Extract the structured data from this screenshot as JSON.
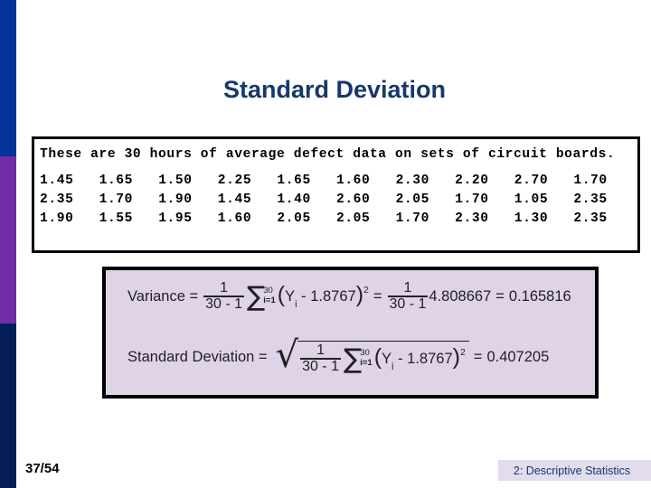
{
  "slide": {
    "title": "Standard Deviation",
    "page_number": "37/54",
    "footer_chapter": "2: Descriptive Statistics",
    "accent_colors": {
      "title_blue": "#17386b",
      "stripe_blue": "#04339a",
      "stripe_purple": "#6f2da8",
      "stripe_navy": "#041e5a",
      "formula_box_bg": "#ded3e7",
      "footer_band_bg": "#e2dced"
    }
  },
  "data_box": {
    "intro_text": "These are 30 hours of average defect data on sets of circuit boards.",
    "rows": [
      [
        "1.45",
        "1.65",
        "1.50",
        "2.25",
        "1.65",
        "1.60",
        "2.30",
        "2.20",
        "2.70",
        "1.70"
      ],
      [
        "2.35",
        "1.70",
        "1.90",
        "1.45",
        "1.40",
        "2.60",
        "2.05",
        "1.70",
        "1.05",
        "2.35"
      ],
      [
        "1.90",
        "1.55",
        "1.95",
        "1.60",
        "2.05",
        "2.05",
        "1.70",
        "2.30",
        "1.30",
        "2.35"
      ]
    ]
  },
  "formulas": {
    "variance": {
      "label": "Variance =",
      "frac_numerator": "1",
      "frac_denominator": "30 - 1",
      "sigma_upper": "30",
      "sigma_lower": "i=1",
      "paren_open": "(",
      "term_symbol": "Y",
      "term_subscript": "i",
      "term_rest": " - 1.8767",
      "paren_close": ")",
      "exponent": "2",
      "equals_1": "=",
      "frac2_numerator": "1",
      "frac2_denominator": "30 - 1",
      "sum_of_squares": "4.808667",
      "equals_2": "=",
      "result": "0.165816"
    },
    "standard_deviation": {
      "label": "Standard Deviation =",
      "frac_numerator": "1",
      "frac_denominator": "30 - 1",
      "sigma_upper": "30",
      "sigma_lower": "i=1",
      "paren_open": "(",
      "term_symbol": "Y",
      "term_subscript": "i",
      "term_rest": " - 1.8767",
      "paren_close": ")",
      "exponent": "2",
      "equals_1": "=",
      "result": "0.407205"
    }
  }
}
